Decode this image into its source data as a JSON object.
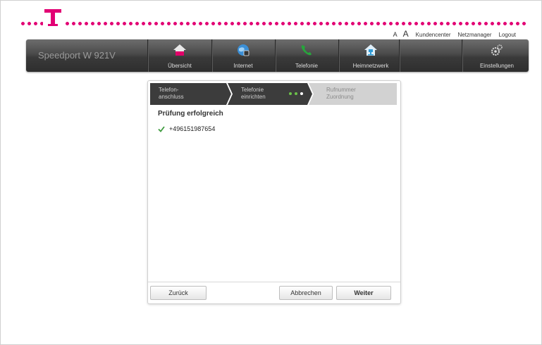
{
  "header": {
    "font_small": "A",
    "font_large": "A",
    "links": [
      "Kundencenter",
      "Netzmanager",
      "Logout"
    ],
    "brand_color": "#e20074"
  },
  "navbar": {
    "device_name": "Speedport W 921V",
    "items": [
      {
        "label": "Übersicht",
        "icon": "home-icon",
        "color": "#e8e8e8"
      },
      {
        "label": "Internet",
        "icon": "globe-icon",
        "color": "#3b8fd6"
      },
      {
        "label": "Telefonie",
        "icon": "phone-icon",
        "color": "#27a63c"
      },
      {
        "label": "Heimnetzwerk",
        "icon": "home-network-icon",
        "color": "#2e9bd6"
      },
      {
        "label": "Einstellungen",
        "icon": "gears-icon",
        "color": "#d8d8d8"
      }
    ]
  },
  "wizard": {
    "steps": [
      {
        "line1": "Telefon-",
        "line2": "anschluss"
      },
      {
        "line1": "Telefonie",
        "line2": "einrichten"
      },
      {
        "line1": "Rufnummer",
        "line2": "Zuordnung"
      }
    ],
    "step_dots_colors": [
      "#6cc24a",
      "#6cc24a",
      "#ffffff"
    ],
    "status_title": "Prüfung erfolgreich",
    "numbers": [
      "+496151987654"
    ],
    "check_color": "#3e9b3e",
    "buttons": {
      "back": "Zurück",
      "cancel": "Abbrechen",
      "next": "Weiter"
    }
  }
}
